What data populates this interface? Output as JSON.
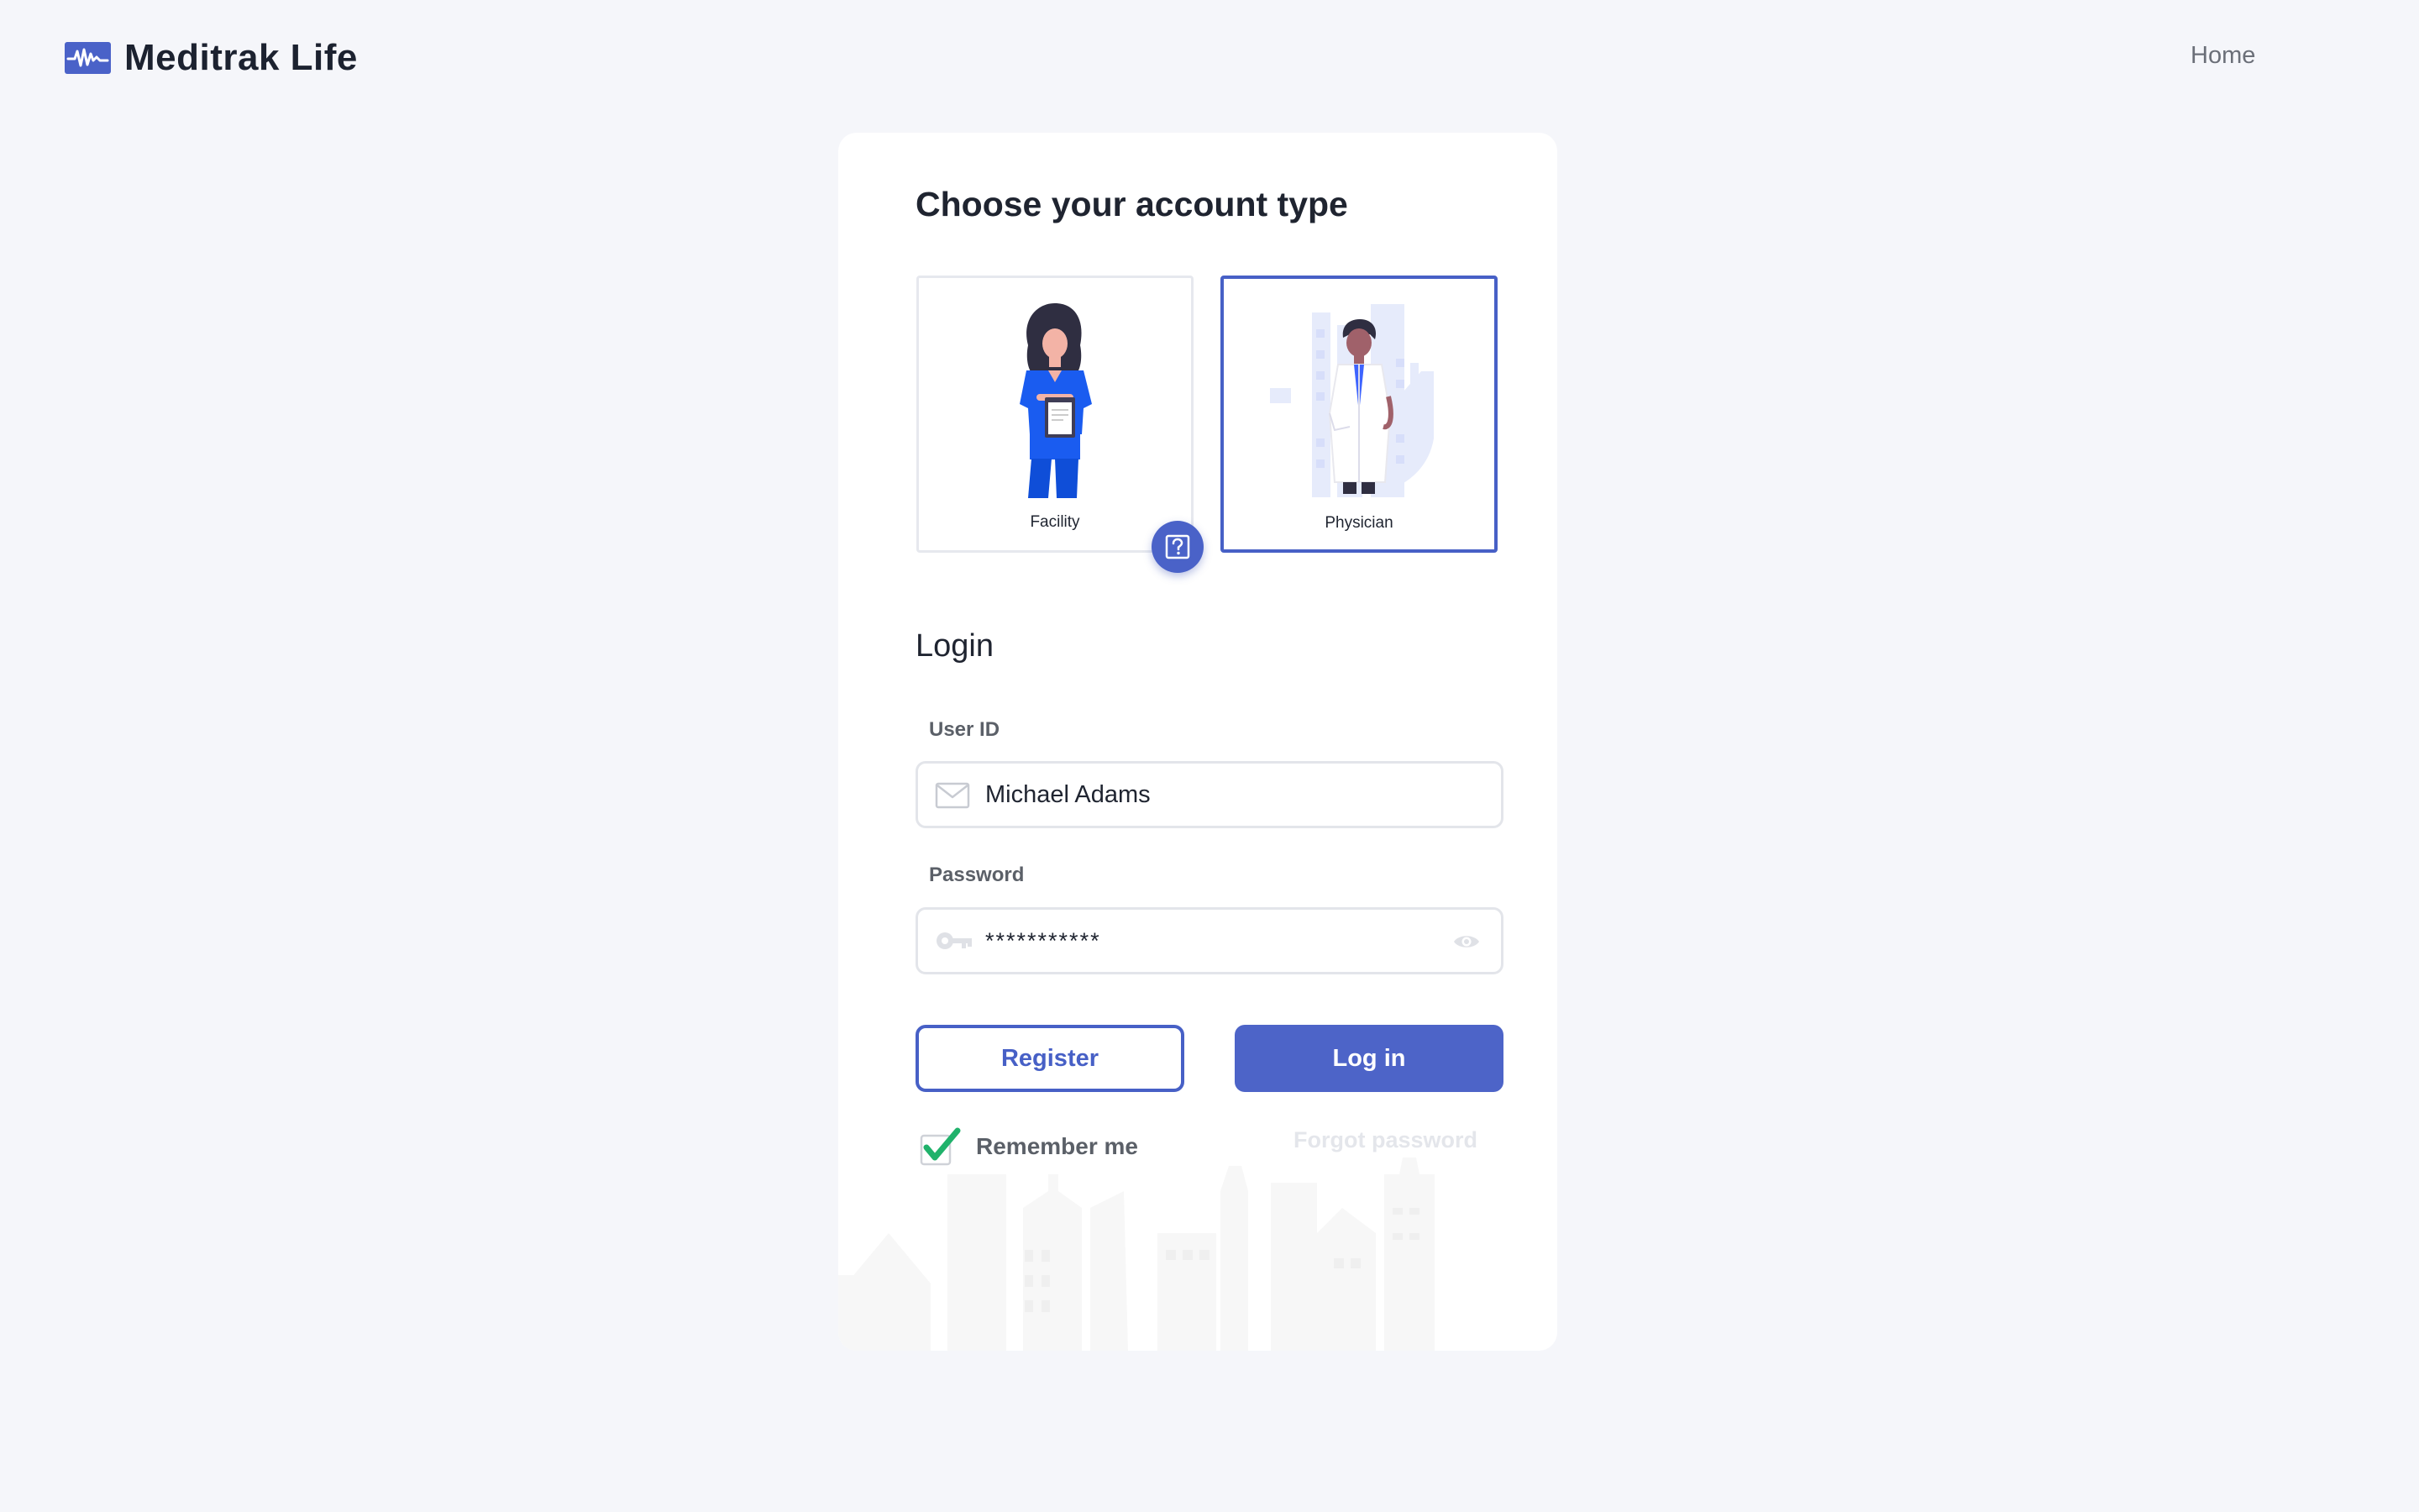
{
  "header": {
    "brand_name": "Meditrak Life",
    "nav_home": "Home"
  },
  "account": {
    "title": "Choose your account type",
    "options": [
      {
        "label": "Facility",
        "selected": false
      },
      {
        "label": "Physician",
        "selected": true
      }
    ]
  },
  "login": {
    "title": "Login",
    "user_label": "User ID",
    "user_value": "Michael Adams",
    "password_label": "Password",
    "password_value": "***********",
    "register_label": "Register",
    "login_label": "Log in",
    "remember_label": "Remember me",
    "remember_checked": true,
    "forgot_label": "Forgot password"
  },
  "colors": {
    "accent": "#4d64c8",
    "accent_border": "#4760c6",
    "check": "#20b26b",
    "background": "#f5f6fa"
  }
}
